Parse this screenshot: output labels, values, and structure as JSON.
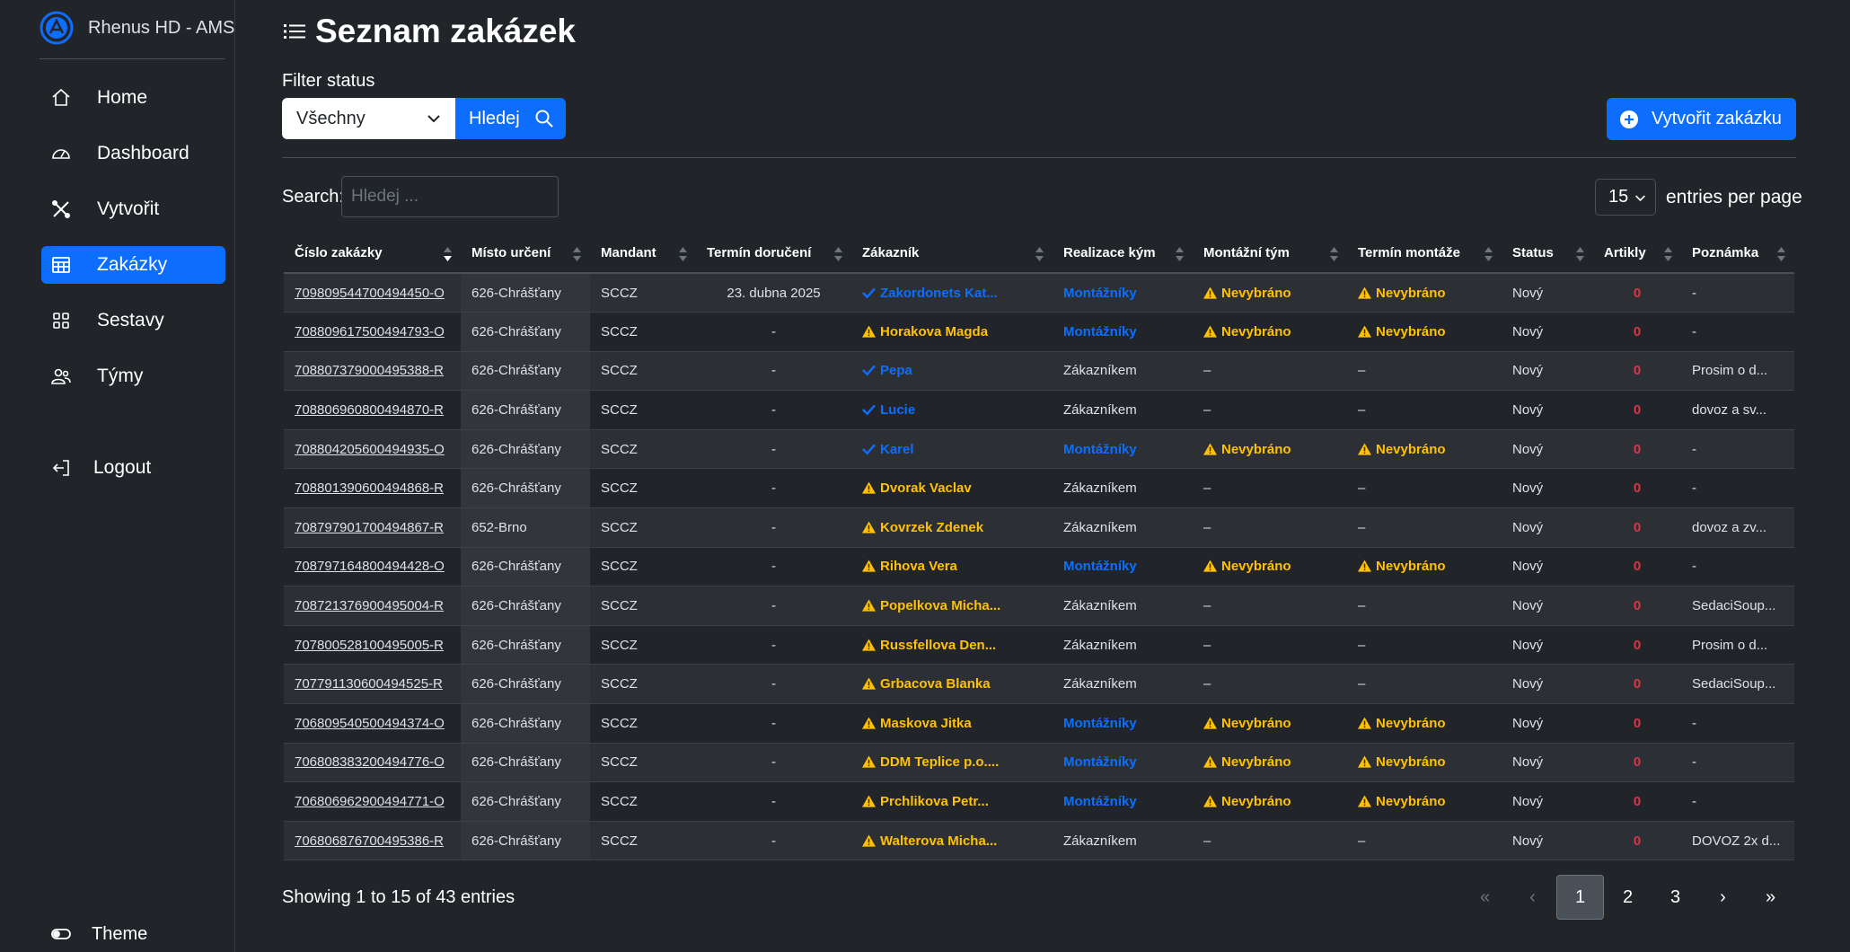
{
  "brand": {
    "name": "Rhenus HD - AMS"
  },
  "nav": {
    "home": "Home",
    "dashboard": "Dashboard",
    "create": "Vytvořit",
    "orders": "Zakázky",
    "sets": "Sestavy",
    "teams": "Týmy",
    "logout": "Logout",
    "theme": "Theme"
  },
  "page": {
    "title": "Seznam zakázek"
  },
  "filter": {
    "label": "Filter status",
    "value": "Všechny",
    "search_button": "Hledej"
  },
  "create_button": "Vytvořit zakázku",
  "search": {
    "label": "Search:",
    "placeholder": "Hledej ..."
  },
  "per_page": {
    "value": "15",
    "label": "entries per page"
  },
  "columns": [
    "Číslo zakázky",
    "Místo určení",
    "Mandant",
    "Termín doručení",
    "Zákazník",
    "Realizace kým",
    "Montážní tým",
    "Termín montáže",
    "Status",
    "Artikly",
    "Poznámka"
  ],
  "rows": [
    {
      "id": "709809544700494450-O",
      "place": "626-Chrášťany",
      "mandant": "SCCZ",
      "delivery": "23. dubna 2025",
      "customer": "Zakordonets Kat...",
      "customer_state": "ok",
      "realization": "Montážníky",
      "team": "Nevybráno",
      "date": "Nevybráno",
      "status": "Nový",
      "articles": "0",
      "note": "-"
    },
    {
      "id": "708809617500494793-O",
      "place": "626-Chrášťany",
      "mandant": "SCCZ",
      "delivery": "-",
      "customer": "Horakova Magda",
      "customer_state": "warn",
      "realization": "Montážníky",
      "team": "Nevybráno",
      "date": "Nevybráno",
      "status": "Nový",
      "articles": "0",
      "note": "-"
    },
    {
      "id": "708807379000495388-R",
      "place": "626-Chrášťany",
      "mandant": "SCCZ",
      "delivery": "-",
      "customer": "Pepa",
      "customer_state": "ok",
      "realization": "Zákazníkem",
      "team": "–",
      "date": "–",
      "status": "Nový",
      "articles": "0",
      "note": "Prosim o d..."
    },
    {
      "id": "708806960800494870-R",
      "place": "626-Chrášťany",
      "mandant": "SCCZ",
      "delivery": "-",
      "customer": "Lucie",
      "customer_state": "ok",
      "realization": "Zákazníkem",
      "team": "–",
      "date": "–",
      "status": "Nový",
      "articles": "0",
      "note": "dovoz a sv..."
    },
    {
      "id": "708804205600494935-O",
      "place": "626-Chrášťany",
      "mandant": "SCCZ",
      "delivery": "-",
      "customer": "Karel",
      "customer_state": "ok",
      "realization": "Montážníky",
      "team": "Nevybráno",
      "date": "Nevybráno",
      "status": "Nový",
      "articles": "0",
      "note": "-"
    },
    {
      "id": "708801390600494868-R",
      "place": "626-Chrášťany",
      "mandant": "SCCZ",
      "delivery": "-",
      "customer": "Dvorak Vaclav",
      "customer_state": "warn",
      "realization": "Zákazníkem",
      "team": "–",
      "date": "–",
      "status": "Nový",
      "articles": "0",
      "note": "-"
    },
    {
      "id": "708797901700494867-R",
      "place": "652-Brno",
      "mandant": "SCCZ",
      "delivery": "-",
      "customer": "Kovrzek Zdenek",
      "customer_state": "warn",
      "realization": "Zákazníkem",
      "team": "–",
      "date": "–",
      "status": "Nový",
      "articles": "0",
      "note": "dovoz a zv..."
    },
    {
      "id": "708797164800494428-O",
      "place": "626-Chrášťany",
      "mandant": "SCCZ",
      "delivery": "-",
      "customer": "Rihova Vera",
      "customer_state": "warn",
      "realization": "Montážníky",
      "team": "Nevybráno",
      "date": "Nevybráno",
      "status": "Nový",
      "articles": "0",
      "note": "-"
    },
    {
      "id": "708721376900495004-R",
      "place": "626-Chrášťany",
      "mandant": "SCCZ",
      "delivery": "-",
      "customer": "Popelkova Micha...",
      "customer_state": "warn",
      "realization": "Zákazníkem",
      "team": "–",
      "date": "–",
      "status": "Nový",
      "articles": "0",
      "note": "SedaciSoup..."
    },
    {
      "id": "707800528100495005-R",
      "place": "626-Chrášťany",
      "mandant": "SCCZ",
      "delivery": "-",
      "customer": "Russfellova Den...",
      "customer_state": "warn",
      "realization": "Zákazníkem",
      "team": "–",
      "date": "–",
      "status": "Nový",
      "articles": "0",
      "note": "Prosim o d..."
    },
    {
      "id": "707791130600494525-R",
      "place": "626-Chrášťany",
      "mandant": "SCCZ",
      "delivery": "-",
      "customer": "Grbacova Blanka",
      "customer_state": "warn",
      "realization": "Zákazníkem",
      "team": "–",
      "date": "–",
      "status": "Nový",
      "articles": "0",
      "note": "SedaciSoup..."
    },
    {
      "id": "706809540500494374-O",
      "place": "626-Chrášťany",
      "mandant": "SCCZ",
      "delivery": "-",
      "customer": "Maskova Jitka",
      "customer_state": "warn",
      "realization": "Montážníky",
      "team": "Nevybráno",
      "date": "Nevybráno",
      "status": "Nový",
      "articles": "0",
      "note": "-"
    },
    {
      "id": "706808383200494776-O",
      "place": "626-Chrášťany",
      "mandant": "SCCZ",
      "delivery": "-",
      "customer": "DDM Teplice p.o....",
      "customer_state": "warn",
      "realization": "Montážníky",
      "team": "Nevybráno",
      "date": "Nevybráno",
      "status": "Nový",
      "articles": "0",
      "note": "-"
    },
    {
      "id": "706806962900494771-O",
      "place": "626-Chrášťany",
      "mandant": "SCCZ",
      "delivery": "-",
      "customer": "Prchlikova Petr...",
      "customer_state": "warn",
      "realization": "Montážníky",
      "team": "Nevybráno",
      "date": "Nevybráno",
      "status": "Nový",
      "articles": "0",
      "note": "-"
    },
    {
      "id": "706806876700495386-R",
      "place": "626-Chrášťany",
      "mandant": "SCCZ",
      "delivery": "-",
      "customer": "Walterova Micha...",
      "customer_state": "warn",
      "realization": "Zákazníkem",
      "team": "–",
      "date": "–",
      "status": "Nový",
      "articles": "0",
      "note": "DOVOZ 2x d..."
    }
  ],
  "footer": {
    "showing": "Showing 1 to 15 of 43 entries"
  },
  "pagination": {
    "first": "«",
    "prev": "‹",
    "pages": [
      "1",
      "2",
      "3"
    ],
    "current": "1",
    "next": "›",
    "last": "»"
  },
  "colors": {
    "accent": "#0d6efd",
    "warning": "#ffc107",
    "danger": "#dc3545",
    "background": "#212529"
  }
}
